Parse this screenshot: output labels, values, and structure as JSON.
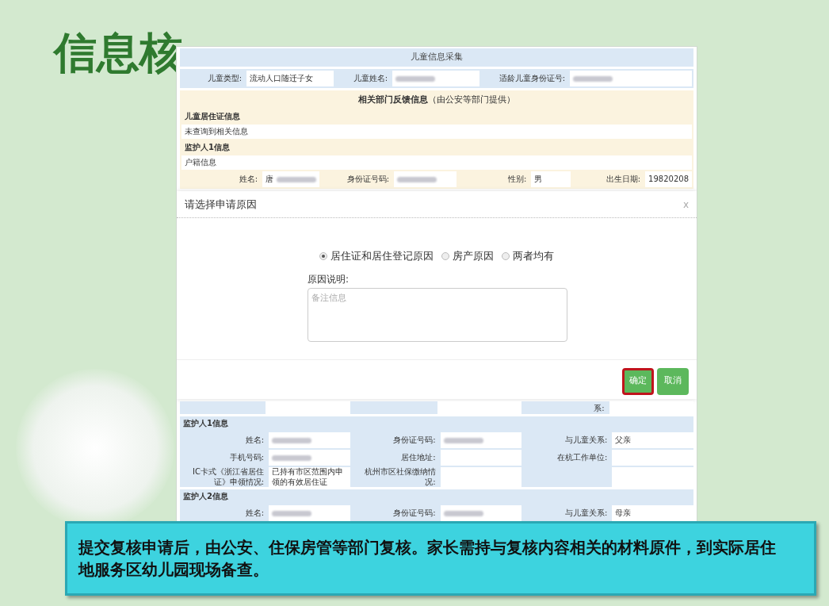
{
  "slide": {
    "title": "信息核"
  },
  "form": {
    "header": "儿童信息采集",
    "child_row": [
      {
        "label": "儿童类型:",
        "value": "流动人口随迁子女",
        "redacted": false
      },
      {
        "label": "儿童姓名:",
        "redacted": true
      },
      {
        "label": "适龄儿童身份证号:",
        "redacted": true
      }
    ],
    "feedback": {
      "title": "**相关部门反馈信息**（由公安等部门提供）",
      "rows": [
        {
          "kind": "heading",
          "text": "儿童居住证信息"
        },
        {
          "kind": "text",
          "text": "未查询到相关信息"
        },
        {
          "kind": "heading",
          "text": "监护人1信息"
        },
        {
          "kind": "text",
          "text": "户籍信息"
        }
      ],
      "fields": [
        {
          "label": "姓名:",
          "value": "唐",
          "redacted": true
        },
        {
          "label": "身份证号码:",
          "redacted": true
        },
        {
          "label": "性别:",
          "value": "男",
          "redacted": false
        },
        {
          "label": "出生日期:",
          "value": "19820208",
          "redacted": false
        }
      ]
    },
    "partial_label": "系:",
    "guardians": [
      {
        "title": "监护人1信息",
        "rows": [
          [
            {
              "label": "姓名:",
              "redacted": true
            },
            {
              "label": "身份证号码:",
              "redacted": true
            },
            {
              "label": "与儿童关系:",
              "value": "父亲",
              "redacted": false
            }
          ],
          [
            {
              "label": "手机号码:",
              "redacted": true
            },
            {
              "label": "居住地址:",
              "redacted": false
            },
            {
              "label": "在杭工作单位:",
              "redacted": false
            }
          ],
          [
            {
              "label": "IC卡式《浙江省居住证》申领情况:",
              "value": "已持有市区范围内申领的有效居住证",
              "redacted": false
            },
            {
              "label": "杭州市区社保缴纳情况:",
              "redacted": false
            },
            {
              "redacted": false
            }
          ]
        ]
      },
      {
        "title": "监护人2信息",
        "rows": [
          [
            {
              "label": "姓名:",
              "redacted": true
            },
            {
              "label": "身份证号码:",
              "redacted": true
            },
            {
              "label": "与儿童关系:",
              "value": "母亲",
              "redacted": false
            }
          ]
        ]
      }
    ]
  },
  "dialog": {
    "title": "请选择申请原因",
    "close": "x",
    "options": [
      {
        "label": "居住证和居住登记原因",
        "selected": true
      },
      {
        "label": "房产原因",
        "selected": false
      },
      {
        "label": "两者均有",
        "selected": false
      }
    ],
    "reason_label": "原因说明:",
    "reason_placeholder": "备注信息",
    "buttons": [
      {
        "label": "确定",
        "highlighted": true
      },
      {
        "label": "取消",
        "highlighted": false
      }
    ]
  },
  "caption": "提交复核申请后，由公安、住保房管等部门复核。家长需持与复核内容相关的材料原件，到实际居住地服务区幼儿园现场备查。"
}
